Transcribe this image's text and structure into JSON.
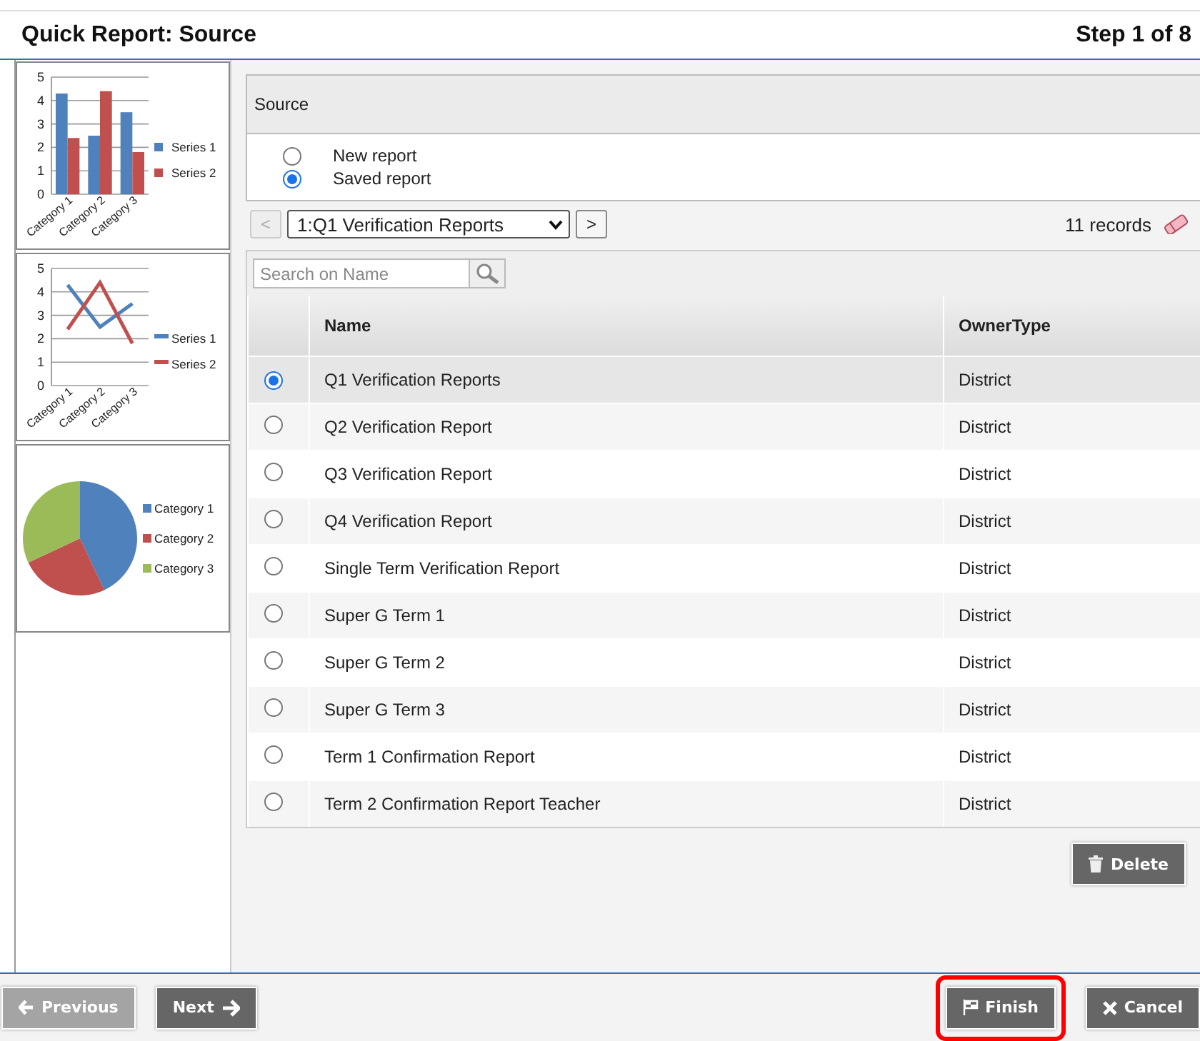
{
  "header": {
    "title": "Quick Report: Source",
    "step": "Step 1 of 8"
  },
  "thumbnails": [
    {
      "chart_data": {
        "type": "bar",
        "grid": true,
        "legend": true,
        "categories": [
          "Category 1",
          "Category 2",
          "Category 3"
        ],
        "ylim": [
          0,
          5
        ],
        "yticks": [
          0,
          1,
          2,
          3,
          4,
          5
        ],
        "series": [
          {
            "name": "Series 1",
            "color": "#4f81bd",
            "values": [
              4.3,
              2.5,
              3.5
            ]
          },
          {
            "name": "Series 2",
            "color": "#c0504d",
            "values": [
              2.4,
              4.4,
              1.8
            ]
          }
        ]
      }
    },
    {
      "chart_data": {
        "type": "line",
        "grid": true,
        "legend": true,
        "categories": [
          "Category 1",
          "Category 2",
          "Category 3"
        ],
        "ylim": [
          0,
          5
        ],
        "yticks": [
          0,
          1,
          2,
          3,
          4,
          5
        ],
        "series": [
          {
            "name": "Series 1",
            "color": "#4f81bd",
            "values": [
              4.3,
              2.5,
              3.5
            ]
          },
          {
            "name": "Series 2",
            "color": "#c0504d",
            "values": [
              2.4,
              4.4,
              1.8
            ]
          }
        ]
      }
    },
    {
      "chart_data": {
        "type": "pie",
        "legend": true,
        "categories": [
          "Category 1",
          "Category 2",
          "Category 3"
        ],
        "values": [
          43,
          25,
          32
        ],
        "colors": [
          "#4f81bd",
          "#c0504d",
          "#9bbb59"
        ]
      }
    }
  ],
  "source": {
    "heading": "Source",
    "options": [
      {
        "label": "New report",
        "selected": false
      },
      {
        "label": "Saved report",
        "selected": true
      }
    ]
  },
  "nav": {
    "prev": {
      "label": "<",
      "disabled": true
    },
    "select": "1:Q1 Verification Reports",
    "next": {
      "label": ">",
      "disabled": false
    },
    "records": "11 records"
  },
  "search": {
    "placeholder": "Search on Name"
  },
  "table": {
    "columns": [
      "Name",
      "OwnerType"
    ],
    "rows": [
      {
        "name": "Q1 Verification Reports",
        "owner": "District",
        "selected": true
      },
      {
        "name": "Q2 Verification Report",
        "owner": "District",
        "selected": false
      },
      {
        "name": "Q3 Verification Report",
        "owner": "District",
        "selected": false
      },
      {
        "name": "Q4 Verification Report",
        "owner": "District",
        "selected": false
      },
      {
        "name": "Single Term Verification Report",
        "owner": "District",
        "selected": false
      },
      {
        "name": "Super G Term 1",
        "owner": "District",
        "selected": false
      },
      {
        "name": "Super G Term 2",
        "owner": "District",
        "selected": false
      },
      {
        "name": "Super G Term 3",
        "owner": "District",
        "selected": false
      },
      {
        "name": "Term 1 Confirmation Report",
        "owner": "District",
        "selected": false
      },
      {
        "name": "Term 2 Confirmation Report Teacher",
        "owner": "District",
        "selected": false
      }
    ]
  },
  "delete": "Delete",
  "footer": {
    "buttons": [
      {
        "label": "Previous",
        "kind": "prev",
        "disabled": true,
        "highlighted": false
      },
      {
        "label": "Next",
        "kind": "next",
        "disabled": false,
        "highlighted": false
      },
      {
        "label": "Finish",
        "kind": "finish",
        "disabled": false,
        "highlighted": true
      },
      {
        "label": "Cancel",
        "kind": "cancel",
        "disabled": false,
        "highlighted": false
      }
    ]
  }
}
